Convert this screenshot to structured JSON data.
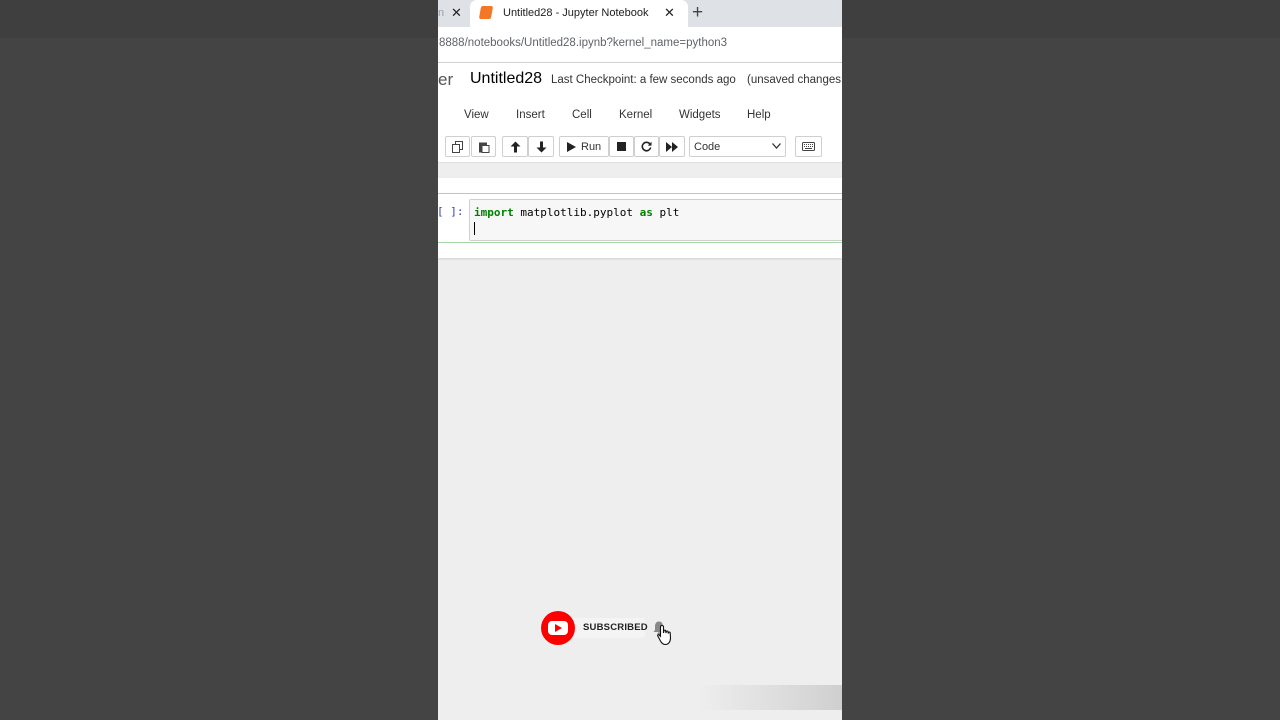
{
  "browser": {
    "prev_tab_fragment": "n",
    "active_tab_title": "Untitled28 - Jupyter Notebook",
    "new_tab_symbol": "+",
    "url": "8888/notebooks/Untitled28.ipynb?kernel_name=python3"
  },
  "header": {
    "logo_fragment": "er",
    "notebook_name": "Untitled28",
    "checkpoint_text": "Last Checkpoint: a few seconds ago",
    "unsaved_text": "(unsaved changes"
  },
  "menu": {
    "items": [
      "View",
      "Insert",
      "Cell",
      "Kernel",
      "Widgets",
      "Help"
    ]
  },
  "toolbar": {
    "run_label": "Run",
    "cell_type_value": "Code",
    "icons": [
      "copy-icon",
      "paste-icon",
      "move-up-icon",
      "move-down-icon",
      "run-icon",
      "stop-icon",
      "restart-icon",
      "fast-forward-icon",
      "keyboard-icon"
    ]
  },
  "cell": {
    "prompt": "[ ]:",
    "keyword_import": "import",
    "module": " matplotlib.pyplot ",
    "keyword_as": "as",
    "alias": " plt"
  },
  "overlay": {
    "subscribe_label": "SUBSCRIBED",
    "colors": {
      "youtube_red": "#ff0000"
    }
  },
  "colors": {
    "jupyter_orange": "#f37726",
    "cell_border_edit": "#a6d8a6",
    "prompt_blue": "#303f9f",
    "keyword_green": "#008000"
  }
}
